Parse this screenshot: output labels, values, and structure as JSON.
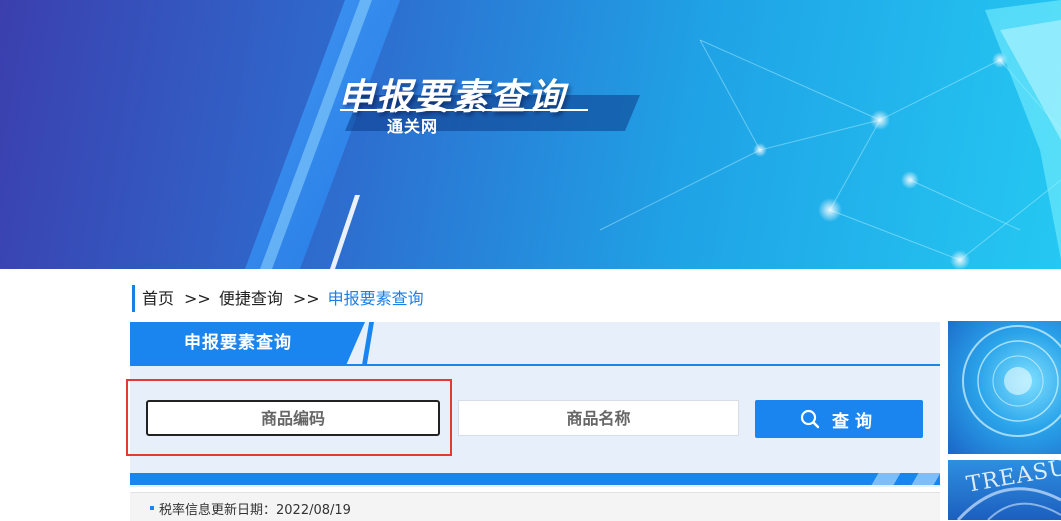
{
  "banner": {
    "title": "申报要素查询",
    "subtitle": "通关网"
  },
  "breadcrumb": {
    "home": "首页",
    "separator": ">>",
    "quick_query": "便捷查询",
    "current": "申报要素查询"
  },
  "panel": {
    "title": "申报要素查询",
    "code_field": {
      "placeholder": "商品编码",
      "value": ""
    },
    "name_field": {
      "placeholder": "商品名称",
      "value": ""
    },
    "search_button": {
      "label": "查询",
      "icon": "search-icon"
    }
  },
  "info": {
    "text": "税率信息更新日期：2022/08/19"
  },
  "side": {
    "thumb2_text": "TREASU"
  },
  "colors": {
    "accent": "#1a84ef",
    "highlight": "#e53935",
    "panel_bg": "#e7f0fa"
  }
}
